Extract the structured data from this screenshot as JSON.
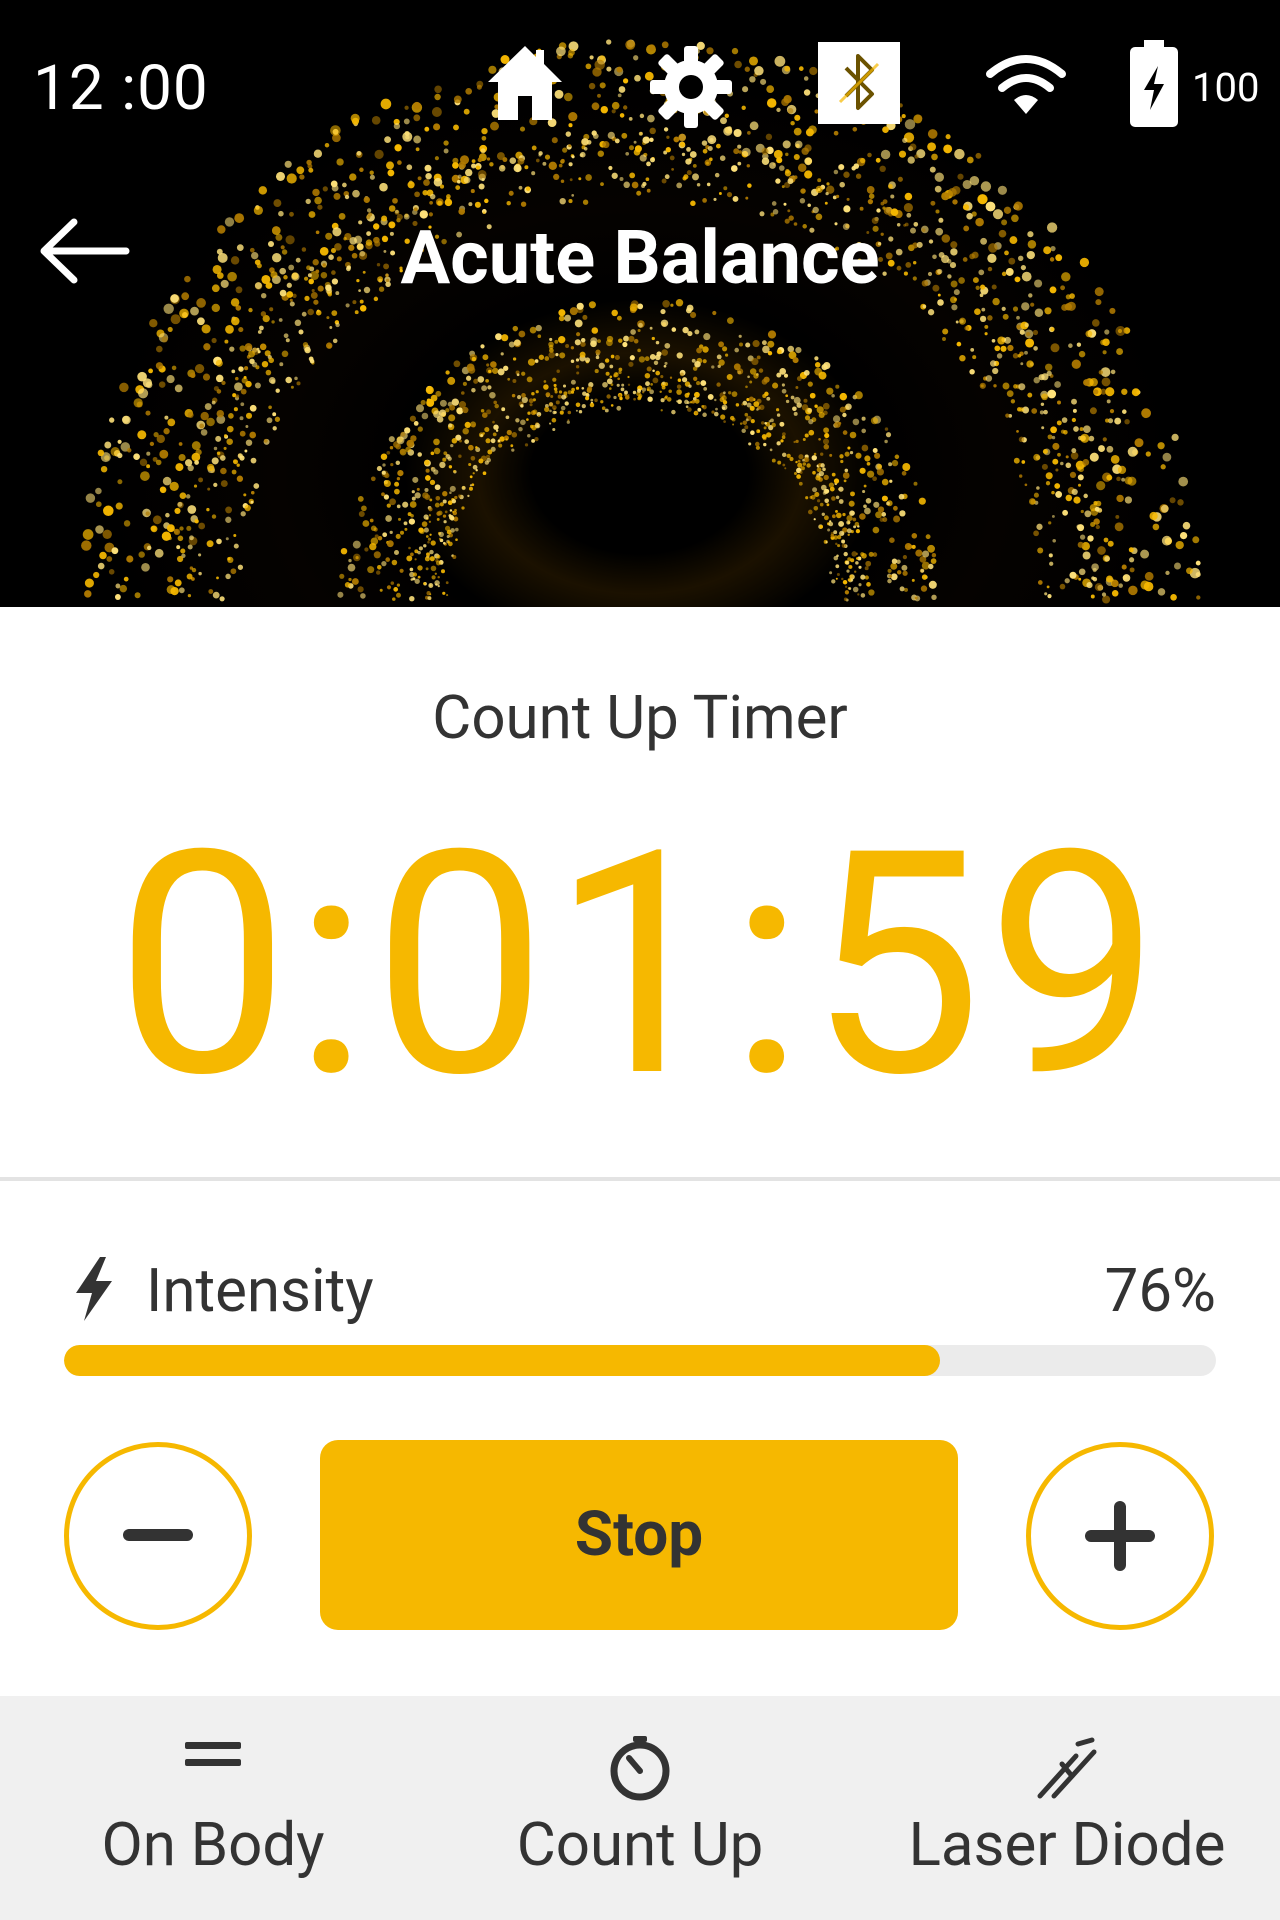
{
  "status_bar": {
    "time": "12 :00",
    "battery_percent": "100",
    "icons": [
      "home-icon",
      "gear-icon",
      "bluetooth-icon",
      "wifi-icon",
      "battery-charging-icon"
    ]
  },
  "header": {
    "title": "Acute Balance",
    "back_icon": "arrow-left-icon"
  },
  "timer": {
    "label": "Count Up Timer",
    "value": "0:01:59"
  },
  "intensity": {
    "label": "Intensity",
    "value_text": "76%",
    "level": 0.76,
    "icon": "lightning-bolt-icon"
  },
  "controls": {
    "decrease_icon": "minus-icon",
    "increase_icon": "plus-icon",
    "stop_label": "Stop"
  },
  "bottom_bar": {
    "items": [
      {
        "label": "On Body",
        "icon": "equals-icon"
      },
      {
        "label": "Count Up",
        "icon": "stopwatch-icon"
      },
      {
        "label": "Laser Diode",
        "icon": "laser-diode-icon"
      }
    ]
  },
  "colors": {
    "accent": "#f6b800",
    "text": "#333333",
    "track": "#ebebeb",
    "bottom_bar_bg": "#f0f0f0"
  }
}
